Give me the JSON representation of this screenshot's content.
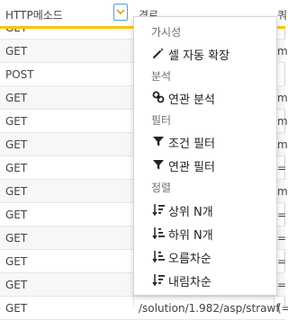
{
  "grid": {
    "columns": [
      "HTTP메소드",
      "경로",
      "쿼"
    ],
    "rows": [
      {
        "method": "GET",
        "url": "",
        "far": ""
      },
      {
        "method": "GET",
        "url": "",
        "far": "m"
      },
      {
        "method": "POST",
        "url": "",
        "far": ""
      },
      {
        "method": "GET",
        "url": "",
        "far": "m"
      },
      {
        "method": "GET",
        "url": "",
        "far": "m"
      },
      {
        "method": "GET",
        "url": "",
        "far": "m"
      },
      {
        "method": "GET",
        "url": "",
        "far": "="
      },
      {
        "method": "GET",
        "url": "",
        "far": "m"
      },
      {
        "method": "GET",
        "url": "",
        "far": "="
      },
      {
        "method": "GET",
        "url": "",
        "far": "="
      },
      {
        "method": "GET",
        "url": "",
        "far": "="
      },
      {
        "method": "GET",
        "url": "",
        "far": "="
      },
      {
        "method": "GET",
        "url": "/solution/1.982/asp/strawf",
        "far": "(="
      }
    ]
  },
  "menu": {
    "visibility_label": "가시성",
    "auto_expand_label": "셀 자동 확장",
    "analysis_label": "분석",
    "related_analysis_label": "연관 분석",
    "filter_label": "필터",
    "condition_filter_label": "조건 필터",
    "related_filter_label": "연관 필터",
    "sort_label": "정렬",
    "top_n_label": "상위 N개",
    "bottom_n_label": "하위 N개",
    "ascending_label": "오름차순",
    "descending_label": "내림차순"
  },
  "colors": {
    "accent": "#ffc107",
    "button_border": "#4aa3df"
  },
  "icons": [
    "chevron-down-icon",
    "magic-wand-icon",
    "link-icon",
    "filter-icon",
    "sort-desc-icon",
    "sort-asc-icon"
  ]
}
